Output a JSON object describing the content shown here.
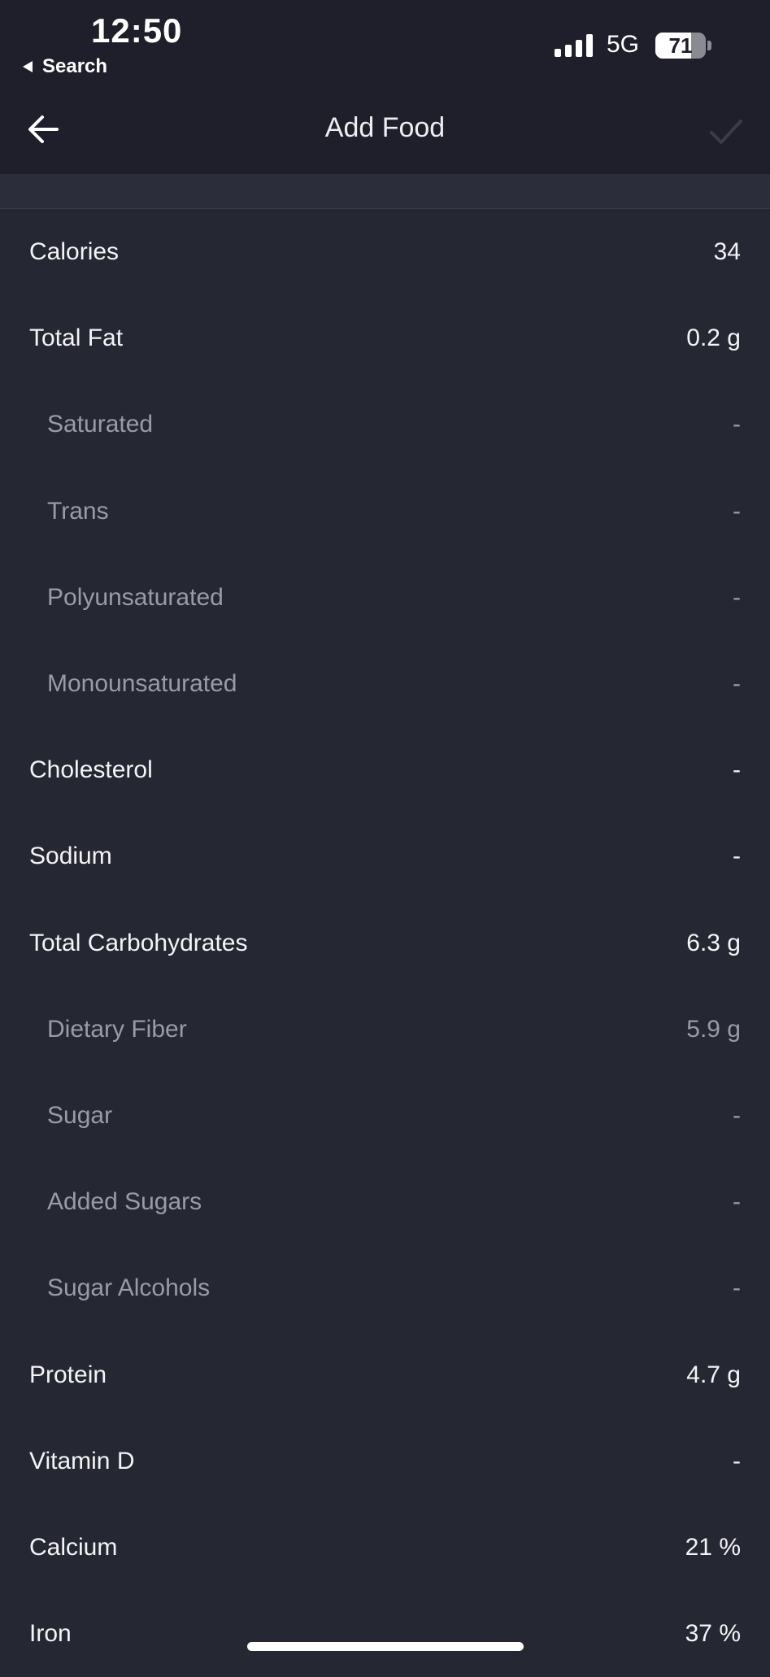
{
  "status_bar": {
    "time": "12:50",
    "back_app": "Search",
    "network": "5G",
    "battery": "71",
    "battery_level": 0.71
  },
  "nav": {
    "title": "Add Food"
  },
  "nutrition": [
    {
      "label": "Calories",
      "value": "34",
      "sub": false
    },
    {
      "label": "Total Fat",
      "value": "0.2 g",
      "sub": false
    },
    {
      "label": "Saturated",
      "value": "-",
      "sub": true
    },
    {
      "label": "Trans",
      "value": "-",
      "sub": true
    },
    {
      "label": "Polyunsaturated",
      "value": "-",
      "sub": true
    },
    {
      "label": "Monounsaturated",
      "value": "-",
      "sub": true
    },
    {
      "label": "Cholesterol",
      "value": "-",
      "sub": false
    },
    {
      "label": "Sodium",
      "value": "-",
      "sub": false
    },
    {
      "label": "Total Carbohydrates",
      "value": "6.3 g",
      "sub": false
    },
    {
      "label": "Dietary Fiber",
      "value": "5.9 g",
      "sub": true
    },
    {
      "label": "Sugar",
      "value": "-",
      "sub": true
    },
    {
      "label": "Added Sugars",
      "value": "-",
      "sub": true
    },
    {
      "label": "Sugar Alcohols",
      "value": "-",
      "sub": true
    },
    {
      "label": "Protein",
      "value": "4.7 g",
      "sub": false
    },
    {
      "label": "Vitamin D",
      "value": "-",
      "sub": false
    },
    {
      "label": "Calcium",
      "value": "21 %",
      "sub": false
    },
    {
      "label": "Iron",
      "value": "37 %",
      "sub": false
    }
  ],
  "colors": {
    "background": "#252733",
    "header": "#1e1f2b",
    "primary_text": "#f4f4f6",
    "secondary_text": "#9a9ba5"
  }
}
